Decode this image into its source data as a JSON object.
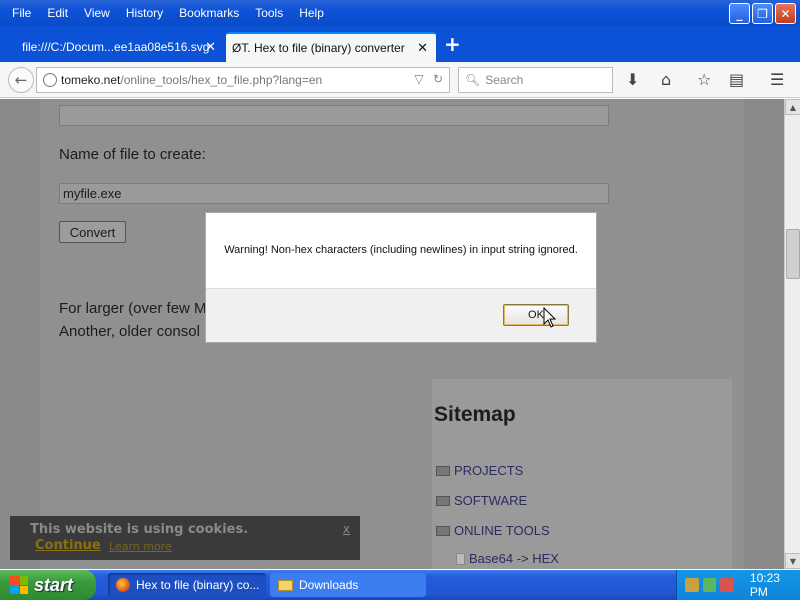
{
  "menu": {
    "items": [
      {
        "label": "File"
      },
      {
        "label": "Edit"
      },
      {
        "label": "View"
      },
      {
        "label": "History"
      },
      {
        "label": "Bookmarks"
      },
      {
        "label": "Tools"
      },
      {
        "label": "Help"
      }
    ]
  },
  "tabs": [
    {
      "label": "file:///C:/Docum...ee1aa08e516.svg",
      "active": false
    },
    {
      "label": "ØT. Hex to file (binary) converter",
      "active": true
    }
  ],
  "address": {
    "host": "tomeko.net",
    "path": "/online_tools/hex_to_file.php?lang=en"
  },
  "search": {
    "placeholder": "Search"
  },
  "page": {
    "name_label": "Name of file to create:",
    "filename_value": "myfile.exe",
    "convert_label": "Convert",
    "text_line1": "For larger (over few M",
    "text_line2": "Another, older consol"
  },
  "sitemap": {
    "title": "Sitemap",
    "items": [
      {
        "label": "PROJECTS",
        "type": "folder"
      },
      {
        "label": "SOFTWARE",
        "type": "folder"
      },
      {
        "label": "ONLINE TOOLS",
        "type": "folder-open"
      },
      {
        "label": "Base64 -> HEX",
        "type": "page"
      }
    ]
  },
  "cookie": {
    "message": "This website is using cookies.",
    "continue": "Continue",
    "learn_more": "Learn more",
    "close": "x"
  },
  "dialog": {
    "message": "Warning! Non-hex characters (including newlines) in input string ignored.",
    "ok_label": "OK"
  },
  "taskbar": {
    "start_label": "start",
    "tasks": [
      {
        "label": "Hex to file (binary) co...",
        "icon": "firefox-icon"
      },
      {
        "label": "Downloads",
        "icon": "folder-icon"
      }
    ],
    "clock": "10:23 PM"
  },
  "colors": {
    "titlebar": "#0b52d6",
    "page_overlay": "#909090",
    "taskbar": "#245edb",
    "start_button": "#3a9a3a",
    "tray": "#0f84d8"
  }
}
